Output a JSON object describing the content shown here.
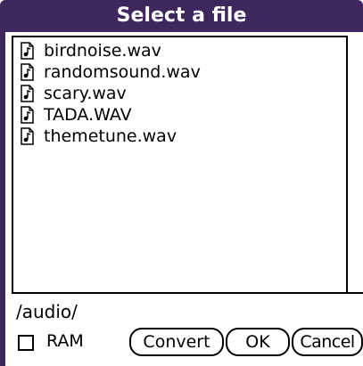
{
  "dialog": {
    "title": "Select a file"
  },
  "files": [
    {
      "name": "birdnoise.wav",
      "icon": "audio-file-icon"
    },
    {
      "name": "randomsound.wav",
      "icon": "audio-file-icon"
    },
    {
      "name": "scary.wav",
      "icon": "audio-file-icon"
    },
    {
      "name": "TADA.WAV",
      "icon": "audio-file-icon"
    },
    {
      "name": "themetune.wav",
      "icon": "audio-file-icon"
    }
  ],
  "path": "/audio/",
  "ram": {
    "label": "RAM",
    "checked": false
  },
  "buttons": {
    "convert": "Convert",
    "ok": "OK",
    "cancel": "Cancel"
  },
  "colors": {
    "title_bar": "#3d275c",
    "title_text": "#ffffff"
  }
}
